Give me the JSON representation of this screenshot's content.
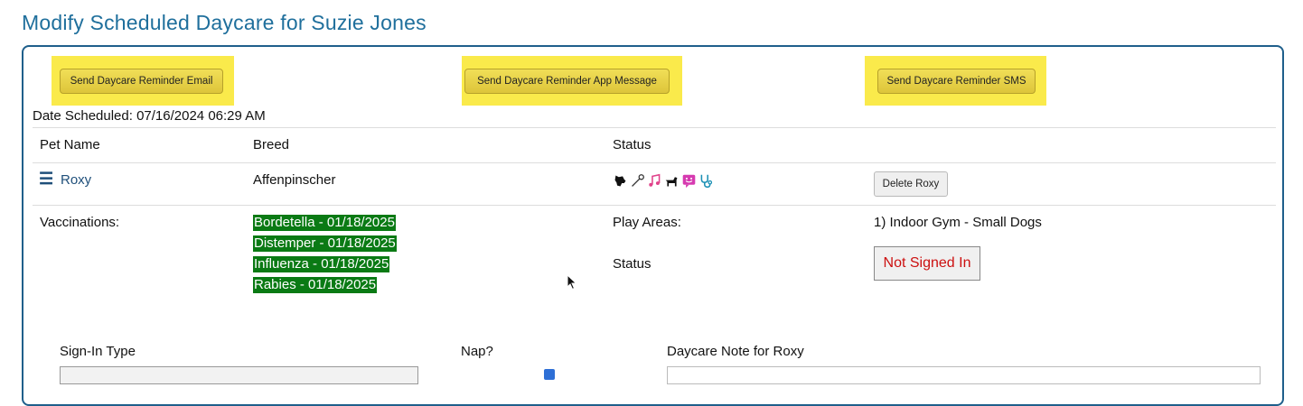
{
  "title": "Modify Scheduled Daycare for Suzie Jones",
  "buttons": {
    "email": "Send Daycare Reminder Email",
    "app": "Send Daycare Reminder App Message",
    "sms": "Send Daycare Reminder SMS"
  },
  "date_scheduled": "Date Scheduled: 07/16/2024 06:29 AM",
  "table": {
    "headers": [
      "Pet Name",
      "Breed",
      "Status"
    ]
  },
  "pet": {
    "name": "Roxy",
    "breed": "Affenpinscher",
    "delete_label": "Delete Roxy",
    "status_icons": [
      "dog-head-icon",
      "leash-icon",
      "music-note-icon",
      "dog-icon",
      "smiley-chat-icon",
      "stethoscope-icon"
    ]
  },
  "vaccinations": {
    "label": "Vaccinations:",
    "items": [
      "Bordetella - 01/18/2025",
      "Distemper - 01/18/2025",
      "Influenza - 01/18/2025",
      "Rabies - 01/18/2025"
    ]
  },
  "play_areas": {
    "label": "Play Areas:",
    "value": "1) Indoor Gym - Small Dogs"
  },
  "status": {
    "label": "Status",
    "value": "Not Signed In"
  },
  "form": {
    "signin_label": "Sign-In Type",
    "nap_label": "Nap?",
    "note_label": "Daycare Note for Roxy"
  },
  "colors": {
    "title": "#1f6f9c",
    "highlight": "#faea4b",
    "vaccination_bg": "#0a7a14",
    "not_signed_in": "#cc1010"
  }
}
